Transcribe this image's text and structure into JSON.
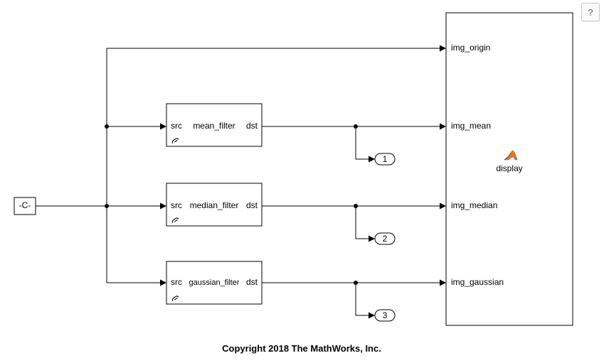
{
  "constant_block": {
    "label": "-C-"
  },
  "filters": {
    "mean": {
      "in_lbl": "src",
      "name": "mean_filter",
      "out_lbl": "dst"
    },
    "median": {
      "in_lbl": "src",
      "name": "median_filter",
      "out_lbl": "dst"
    },
    "gaussian": {
      "in_lbl": "src",
      "name": "gaussian_filter",
      "out_lbl": "dst"
    }
  },
  "outports": {
    "p1": "1",
    "p2": "2",
    "p3": "3"
  },
  "display_block": {
    "ports": {
      "origin": "img_origin",
      "mean": "img_mean",
      "median": "img_median",
      "gaussian": "img_gaussian"
    },
    "label": "display"
  },
  "help_button": {
    "label": "?"
  },
  "footer": {
    "text": "Copyright 2018 The MathWorks, Inc."
  }
}
